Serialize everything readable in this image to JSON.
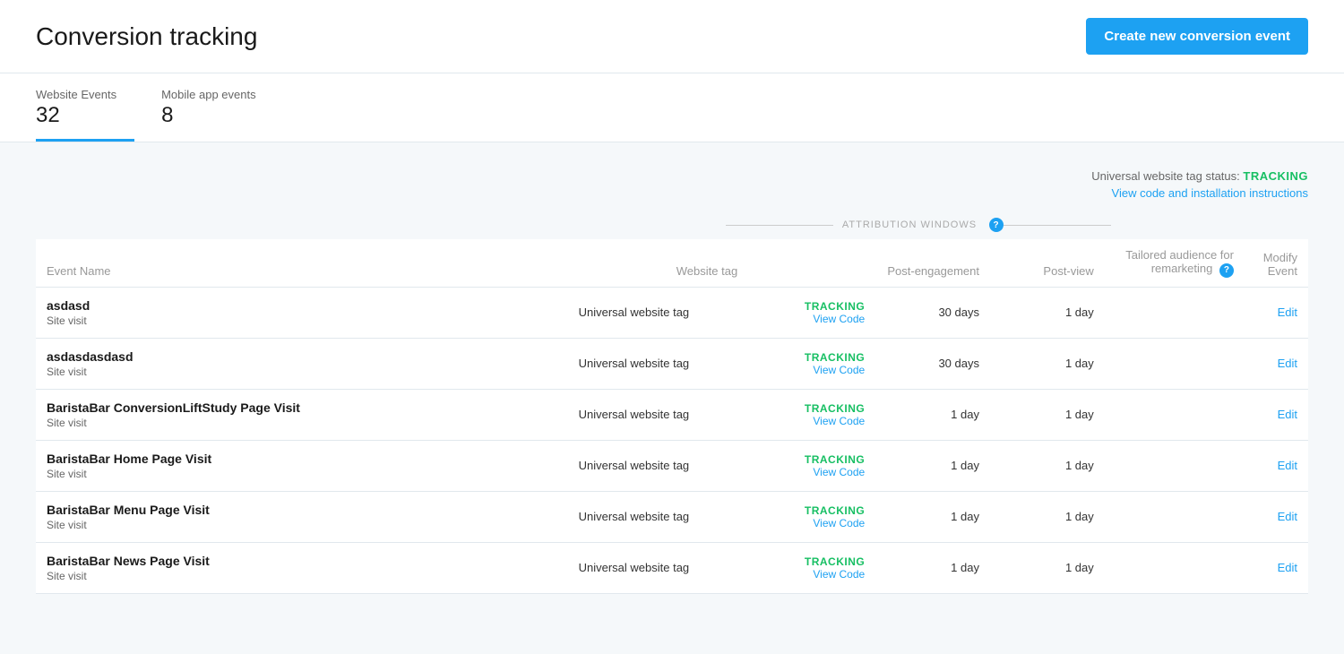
{
  "header": {
    "title": "Conversion tracking",
    "cta_label": "Create new conversion event"
  },
  "tabs": [
    {
      "id": "website",
      "label": "Website Events",
      "count": "32",
      "active": true
    },
    {
      "id": "mobile",
      "label": "Mobile app events",
      "count": "8",
      "active": false
    }
  ],
  "tracking_status": {
    "label": "Universal website tag status:",
    "status": "TRACKING",
    "view_code_label": "View code and installation instructions"
  },
  "attribution_windows": {
    "label": "ATTRIBUTION WINDOWS"
  },
  "table": {
    "columns": {
      "event_name": "Event Name",
      "website_tag": "Website tag",
      "post_engagement": "Post-engagement",
      "post_view": "Post-view",
      "tailored_audience": "Tailored audience for remarketing",
      "modify_event": "Modify Event"
    },
    "rows": [
      {
        "id": 1,
        "name": "asdasd",
        "type": "Site visit",
        "tag": "Universal website tag",
        "tracking_status": "TRACKING",
        "view_code": "View Code",
        "post_engagement": "30 days",
        "post_view": "1 day",
        "tailored_audience": "",
        "edit": "Edit"
      },
      {
        "id": 2,
        "name": "asdasdasdasd",
        "type": "Site visit",
        "tag": "Universal website tag",
        "tracking_status": "TRACKING",
        "view_code": "View Code",
        "post_engagement": "30 days",
        "post_view": "1 day",
        "tailored_audience": "",
        "edit": "Edit"
      },
      {
        "id": 3,
        "name": "BaristaBar ConversionLiftStudy Page Visit",
        "type": "Site visit",
        "tag": "Universal website tag",
        "tracking_status": "TRACKING",
        "view_code": "View Code",
        "post_engagement": "1 day",
        "post_view": "1 day",
        "tailored_audience": "",
        "edit": "Edit"
      },
      {
        "id": 4,
        "name": "BaristaBar Home Page Visit",
        "type": "Site visit",
        "tag": "Universal website tag",
        "tracking_status": "TRACKING",
        "view_code": "View Code",
        "post_engagement": "1 day",
        "post_view": "1 day",
        "tailored_audience": "",
        "edit": "Edit"
      },
      {
        "id": 5,
        "name": "BaristaBar Menu Page Visit",
        "type": "Site visit",
        "tag": "Universal website tag",
        "tracking_status": "TRACKING",
        "view_code": "View Code",
        "post_engagement": "1 day",
        "post_view": "1 day",
        "tailored_audience": "",
        "edit": "Edit"
      },
      {
        "id": 6,
        "name": "BaristaBar News Page Visit",
        "type": "Site visit",
        "tag": "Universal website tag",
        "tracking_status": "TRACKING",
        "view_code": "View Code",
        "post_engagement": "1 day",
        "post_view": "1 day",
        "tailored_audience": "",
        "edit": "Edit"
      }
    ]
  }
}
